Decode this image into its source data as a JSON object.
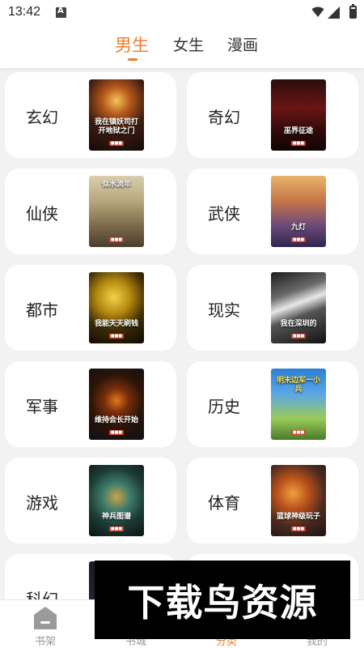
{
  "status_bar": {
    "time": "13:42"
  },
  "header": {
    "tabs": [
      {
        "label": "男生",
        "active": true
      },
      {
        "label": "女生",
        "active": false
      },
      {
        "label": "漫画",
        "active": false
      }
    ]
  },
  "categories": [
    {
      "label": "玄幻",
      "cover_title": "我在镇妖司打开地狱之门"
    },
    {
      "label": "奇幻",
      "cover_title": "巫界征途"
    },
    {
      "label": "仙侠",
      "cover_title": "似水流年"
    },
    {
      "label": "武侠",
      "cover_title": "九灯"
    },
    {
      "label": "都市",
      "cover_title": "我能天天刷钱"
    },
    {
      "label": "现实",
      "cover_title": "我在深圳的"
    },
    {
      "label": "军事",
      "cover_title": "维持会长开始"
    },
    {
      "label": "历史",
      "cover_title": "明末边军一小兵"
    },
    {
      "label": "游戏",
      "cover_title": "神兵图谱"
    },
    {
      "label": "体育",
      "cover_title": "篮球神级玩子"
    },
    {
      "label": "科幻",
      "cover_title": ""
    }
  ],
  "bottom_nav": [
    {
      "label": "书架",
      "active": false
    },
    {
      "label": "书城",
      "active": false
    },
    {
      "label": "分类",
      "active": true
    },
    {
      "label": "我的",
      "active": false
    }
  ],
  "watermark": "下载鸟资源",
  "colors": {
    "accent": "#f07c2c",
    "background": "#f2f2f2",
    "card": "#ffffff"
  }
}
